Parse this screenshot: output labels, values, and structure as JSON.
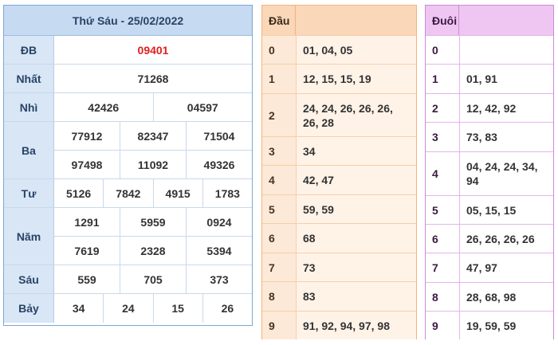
{
  "results": {
    "title": "Thứ Sáu - 25/02/2022",
    "prizes": [
      {
        "label": "ĐB",
        "rows": [
          [
            "09401"
          ]
        ],
        "special": true
      },
      {
        "label": "Nhất",
        "rows": [
          [
            "71268"
          ]
        ]
      },
      {
        "label": "Nhì",
        "rows": [
          [
            "42426",
            "04597"
          ]
        ]
      },
      {
        "label": "Ba",
        "rows": [
          [
            "77912",
            "82347",
            "71504"
          ],
          [
            "97498",
            "11092",
            "49326"
          ]
        ]
      },
      {
        "label": "Tư",
        "rows": [
          [
            "5126",
            "7842",
            "4915",
            "1783"
          ]
        ]
      },
      {
        "label": "Năm",
        "rows": [
          [
            "1291",
            "5959",
            "0924"
          ],
          [
            "7619",
            "2328",
            "5394"
          ]
        ]
      },
      {
        "label": "Sáu",
        "rows": [
          [
            "559",
            "705",
            "373"
          ]
        ]
      },
      {
        "label": "Bảy",
        "rows": [
          [
            "34",
            "24",
            "15",
            "26"
          ]
        ]
      }
    ]
  },
  "dau": {
    "header": "Đầu",
    "rows": [
      {
        "k": "0",
        "v": "01, 04, 05"
      },
      {
        "k": "1",
        "v": "12, 15, 15, 19"
      },
      {
        "k": "2",
        "v": "24, 24, 26, 26, 26, 26, 28"
      },
      {
        "k": "3",
        "v": "34"
      },
      {
        "k": "4",
        "v": "42, 47"
      },
      {
        "k": "5",
        "v": "59, 59"
      },
      {
        "k": "6",
        "v": "68"
      },
      {
        "k": "7",
        "v": "73"
      },
      {
        "k": "8",
        "v": "83"
      },
      {
        "k": "9",
        "v": "91, 92, 94, 97, 98"
      }
    ]
  },
  "duoi": {
    "header": "Đuôi",
    "rows": [
      {
        "k": "0",
        "v": ""
      },
      {
        "k": "1",
        "v": "01, 91"
      },
      {
        "k": "2",
        "v": "12, 42, 92"
      },
      {
        "k": "3",
        "v": "73, 83"
      },
      {
        "k": "4",
        "v": "04, 24, 24, 34, 94"
      },
      {
        "k": "5",
        "v": "05, 15, 15"
      },
      {
        "k": "6",
        "v": "26, 26, 26, 26"
      },
      {
        "k": "7",
        "v": "47, 97"
      },
      {
        "k": "8",
        "v": "28, 68, 98"
      },
      {
        "k": "9",
        "v": "19, 59, 59"
      }
    ]
  },
  "colors": {
    "special": "#e0201e",
    "results_accent": "#c6daf1",
    "dau_accent": "#fad7b8",
    "duoi_accent": "#efc6f2"
  }
}
